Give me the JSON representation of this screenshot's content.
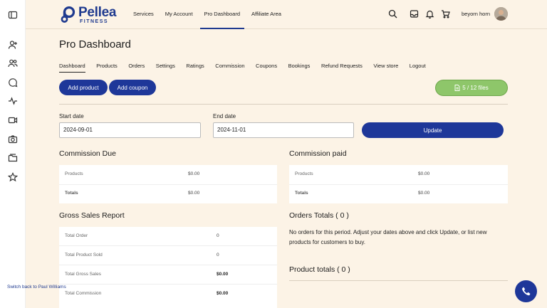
{
  "brand": {
    "name": "Pellea",
    "sub": "FITNESS",
    "accent": "#1f3a8f"
  },
  "sidebar": {
    "icons": [
      "panel-icon",
      "user-plus-icon",
      "users-icon",
      "chat-icon",
      "activity-icon",
      "video-icon",
      "camera-icon",
      "folder-icon",
      "star-icon"
    ]
  },
  "topnav": {
    "items": [
      {
        "label": "Services"
      },
      {
        "label": "My Account"
      },
      {
        "label": "Pro Dashboard",
        "active": true
      },
      {
        "label": "Affiliate Area"
      }
    ],
    "user_name": "beyorn horn"
  },
  "page": {
    "title": "Pro Dashboard",
    "tabs": [
      "Dashboard",
      "Products",
      "Orders",
      "Settings",
      "Ratings",
      "Commission",
      "Coupons",
      "Bookings",
      "Refund Requests",
      "View store",
      "Logout"
    ],
    "add_product": "Add product",
    "add_coupon": "Add coupon",
    "files": "5 / 12 files"
  },
  "filters": {
    "start_label": "Start date",
    "start_value": "2024-09-01",
    "end_label": "End date",
    "end_value": "2024-11-01",
    "update": "Update"
  },
  "commission_due": {
    "title": "Commission Due",
    "rows": [
      {
        "label": "Products",
        "value": "$0.00"
      },
      {
        "label": "Totals",
        "value": "$0.00"
      }
    ]
  },
  "commission_paid": {
    "title": "Commission paid",
    "rows": [
      {
        "label": "Products",
        "value": "$0.00"
      },
      {
        "label": "Totals",
        "value": "$0.00"
      }
    ]
  },
  "gross_sales": {
    "title": "Gross Sales Report",
    "rows": [
      {
        "label": "Total Order",
        "value": "0"
      },
      {
        "label": "Total Product Sold",
        "value": "0"
      },
      {
        "label": "Total Gross Sales",
        "value": "$0.00"
      },
      {
        "label": "Total Commission",
        "value": "$0.00"
      }
    ]
  },
  "orders_totals": {
    "title": "Orders Totals ( 0 )",
    "message": "No orders for this period. Adjust your dates above and click Update, or list new products for customers to buy."
  },
  "product_totals": {
    "title": "Product totals ( 0 )"
  },
  "switch_back": "Switch back to Paul Williams"
}
